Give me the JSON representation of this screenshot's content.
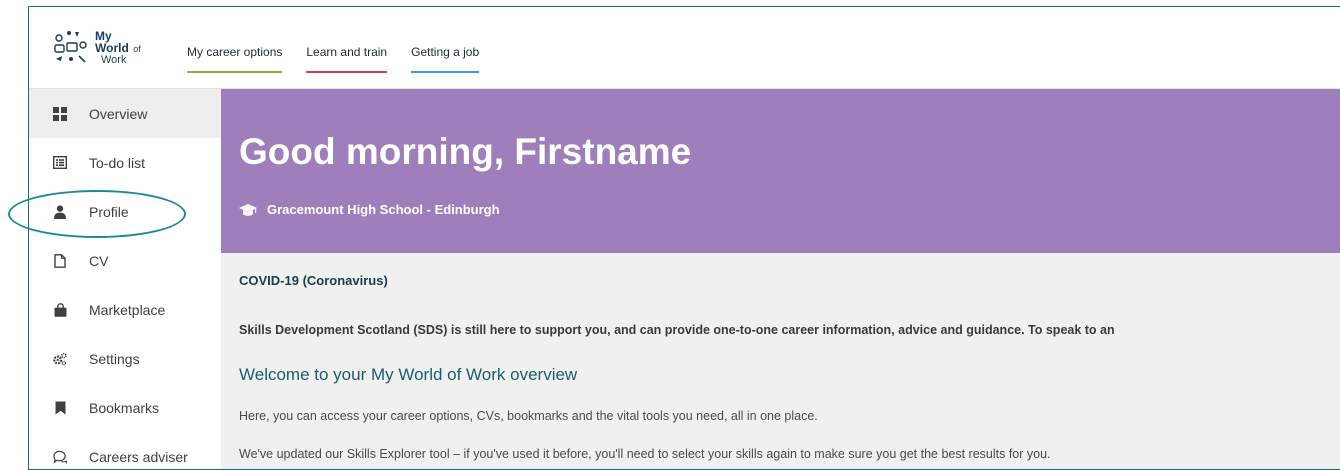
{
  "logo": {
    "line1": "My",
    "line2": "World",
    "line2_suffix": "of",
    "line3": "Work"
  },
  "nav": [
    {
      "label": "My career options",
      "underline_color": "#8ab43a"
    },
    {
      "label": "Learn and train",
      "underline_color": "#d6405a"
    },
    {
      "label": "Getting a job",
      "underline_color": "#3c9ad6"
    }
  ],
  "sidebar": {
    "items": [
      {
        "label": "Overview",
        "icon": "grid-icon",
        "active": true
      },
      {
        "label": "To-do list",
        "icon": "list-icon"
      },
      {
        "label": "Profile",
        "icon": "user-icon"
      },
      {
        "label": "CV",
        "icon": "document-icon"
      },
      {
        "label": "Marketplace",
        "icon": "shopping-bag-icon"
      },
      {
        "label": "Settings",
        "icon": "gears-icon"
      },
      {
        "label": "Bookmarks",
        "icon": "bookmark-icon"
      },
      {
        "label": "Careers adviser",
        "icon": "chat-icon"
      }
    ]
  },
  "banner": {
    "greeting": "Good morning, Firstname",
    "school": "Gracemount High School - Edinburgh",
    "color": "#9f7fbb"
  },
  "content": {
    "covid_title": "COVID-19 (Coronavirus)",
    "sds_text": "Skills Development Scotland (SDS) is still here to support you, and can provide one-to-one career information, advice and guidance. To speak to an",
    "welcome_heading": "Welcome to your My World of Work overview",
    "paragraph1": "Here, you can access your career options, CVs, bookmarks and the vital tools you need, all in one place.",
    "paragraph2": "We've updated our Skills Explorer tool – if you've used it before, you'll need to select your skills again to make sure you get the best results for you."
  },
  "annotation": {
    "color": "#1a8a99"
  }
}
